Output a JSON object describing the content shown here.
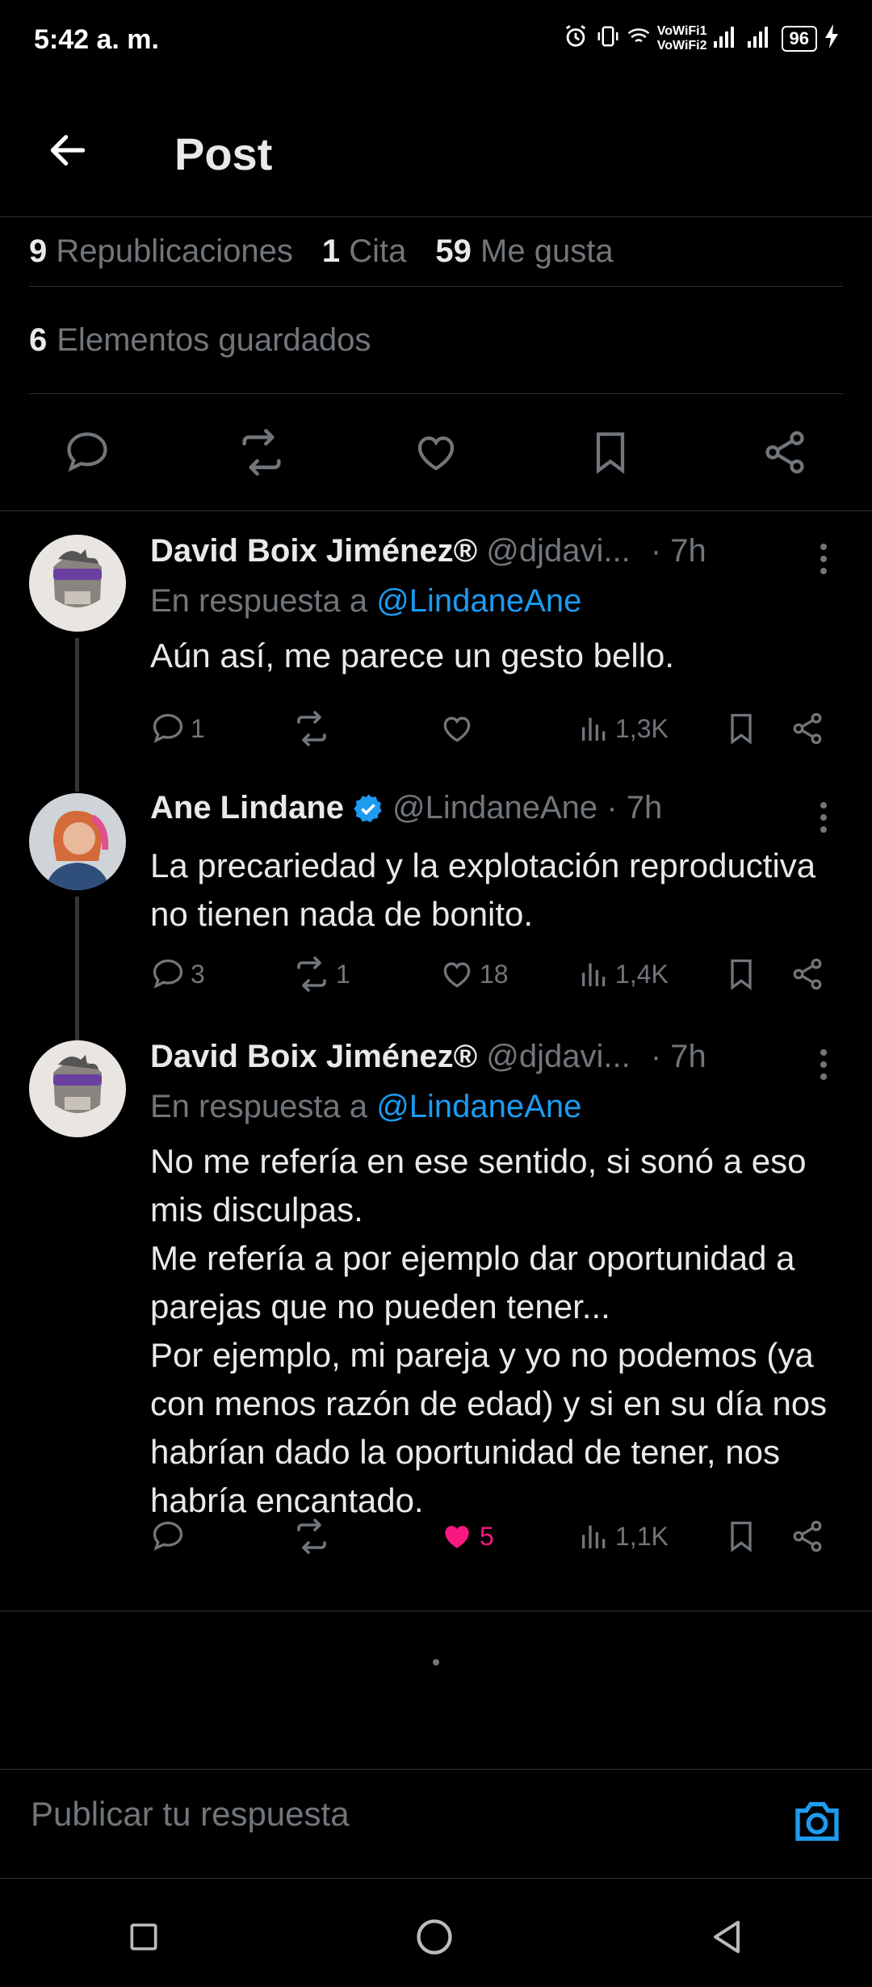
{
  "status": {
    "time": "5:42 a. m.",
    "net1": "VoWiFi1",
    "net2": "VoWiFi2",
    "battery": "96"
  },
  "header": {
    "title": "Post"
  },
  "stats": {
    "reposts_count": "9",
    "reposts_label": "Republicaciones",
    "quotes_count": "1",
    "quotes_label": "Cita",
    "likes_count": "59",
    "likes_label": "Me gusta",
    "saved_count": "6",
    "saved_label": "Elementos guardados"
  },
  "tweets": [
    {
      "name": "David Boix Jiménez®",
      "handle": "@djdavi...",
      "time": "· 7h",
      "reply_prefix": "En respuesta a",
      "reply_to": "@LindaneAne",
      "text": "Aún así, me parece un gesto bello.",
      "replies": "1",
      "reposts": "",
      "likes": "",
      "views": "1,3K"
    },
    {
      "name": "Ane Lindane",
      "handle": "@LindaneAne · 7h",
      "text": "La precariedad y la explotación reproductiva no tienen nada de bonito.",
      "replies": "3",
      "reposts": "1",
      "likes": "18",
      "views": "1,4K"
    },
    {
      "name": "David Boix Jiménez®",
      "handle": "@djdavi...",
      "time": "· 7h",
      "reply_prefix": "En respuesta a",
      "reply_to": "@LindaneAne",
      "text": "No me refería en ese sentido, si sonó a eso mis disculpas.\nMe refería a por ejemplo dar oportunidad a parejas que no pueden tener...\nPor ejemplo, mi pareja y yo no podemos (ya con menos razón de edad) y si en su día nos habrían dado la oportunidad de tener, nos habría encantado.",
      "replies": "",
      "reposts": "",
      "likes": "5",
      "views": "1,1K"
    }
  ],
  "reply": {
    "placeholder": "Publicar tu respuesta"
  },
  "colors": {
    "accent": "#1d9bf0",
    "like": "#f91880",
    "muted": "#71767b",
    "bg": "#000000"
  }
}
